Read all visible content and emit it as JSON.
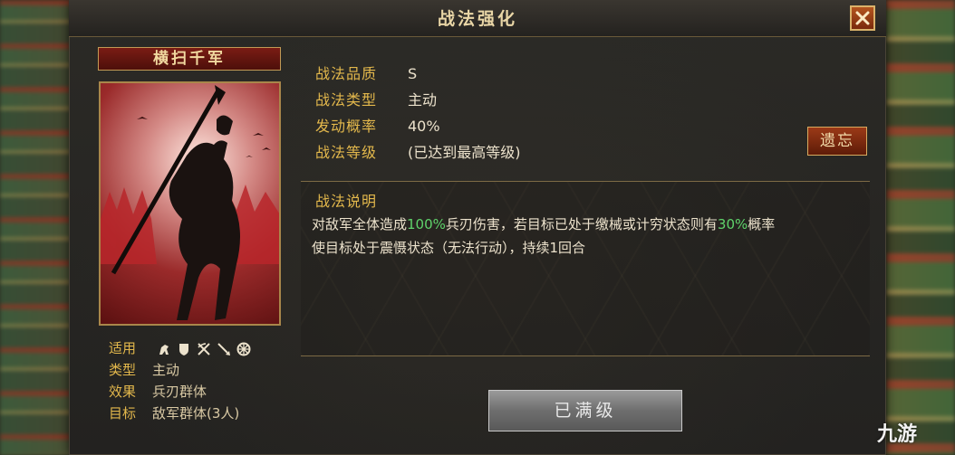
{
  "window": {
    "title": "战法强化"
  },
  "skill": {
    "name": "横扫千军",
    "quality_label": "战法品质",
    "quality": "S",
    "type_label": "战法类型",
    "type": "主动",
    "chance_label": "发动概率",
    "chance": "40%",
    "level_label": "战法等级",
    "level": "(已达到最高等级)"
  },
  "forget_button": "遗忘",
  "description": {
    "title": "战法说明",
    "part1": "对敌军全体造成",
    "pct1": "100%",
    "part2": "兵刃伤害，若目标已处于缴械或计穷状态则有",
    "pct2": "30%",
    "part3": "概率",
    "line2": "使目标处于震慑状态（无法行动），持续1回合"
  },
  "stats": {
    "apply_label": "适用",
    "apply_icons": [
      "cavalry-icon",
      "shield-icon",
      "crossed-bows-icon",
      "spear-icon",
      "wheel-icon"
    ],
    "type_label": "类型",
    "type": "主动",
    "effect_label": "效果",
    "effect": "兵刃群体",
    "target_label": "目标",
    "target": "敌军群体(3人)"
  },
  "max_level_button": "已满级",
  "watermark": "九游",
  "colors": {
    "accent_gold": "#e3b84c",
    "highlight_green": "#5fd36b",
    "text": "#ece2cc"
  }
}
